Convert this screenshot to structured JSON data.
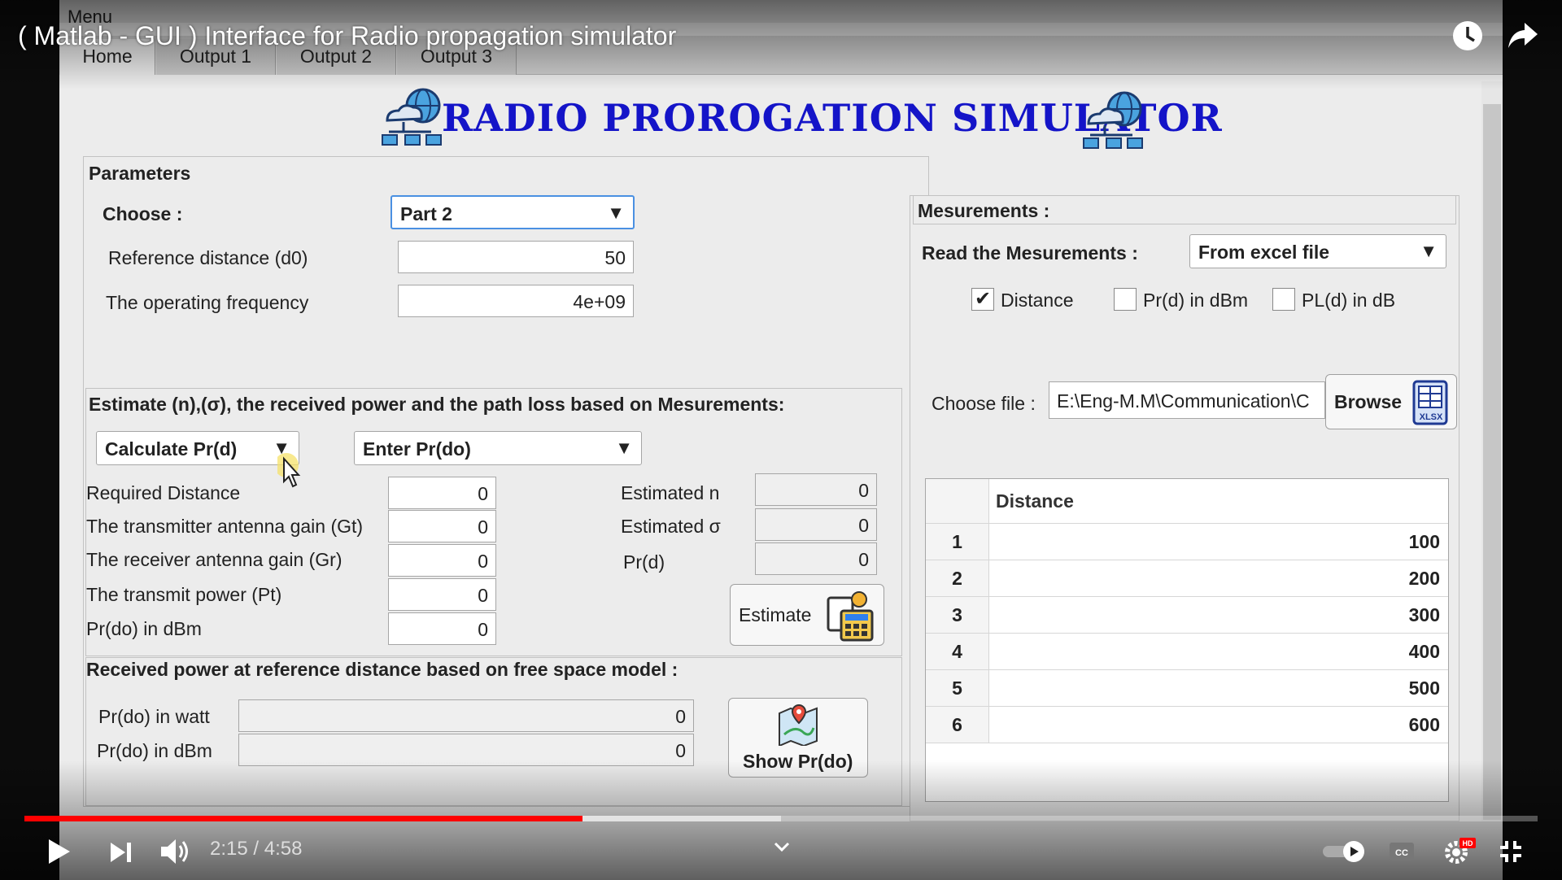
{
  "video": {
    "title": "( Matlab - GUI ) Interface for Radio propagation simulator",
    "time": "2:15 / 4:58",
    "progress_played_fraction": 0.369,
    "progress_buffered_fraction": 0.5
  },
  "app": {
    "menu": "Menu",
    "tabs": [
      {
        "label": "Home",
        "active": true
      },
      {
        "label": "Output 1",
        "active": false
      },
      {
        "label": "Output 2",
        "active": false
      },
      {
        "label": "Output 3",
        "active": false
      }
    ],
    "banner_title": "RADIO PROROGATION SIMULATOR"
  },
  "parameters": {
    "title": "Parameters",
    "choose_label": "Choose :",
    "choose_value": "Part 2",
    "ref_distance_label": "Reference distance (d0)",
    "ref_distance_value": "50",
    "frequency_label": "The operating frequency",
    "frequency_value": "4e+09"
  },
  "estimate": {
    "title": "Estimate (n),(σ), the received power and the path loss based on Mesurements:",
    "calc_dropdown": "Calculate Pr(d)",
    "enter_dropdown": "Enter Pr(do)",
    "inputs": [
      {
        "label": "Required Distance",
        "value": "0"
      },
      {
        "label": "The transmitter antenna gain (Gt)",
        "value": "0"
      },
      {
        "label": "The receiver antenna gain (Gr)",
        "value": "0"
      },
      {
        "label": "The transmit power (Pt)",
        "value": "0"
      },
      {
        "label": "Pr(do) in dBm",
        "value": "0"
      }
    ],
    "outputs": [
      {
        "label": "Estimated n",
        "value": "0"
      },
      {
        "label": "Estimated σ",
        "value": "0"
      },
      {
        "label": "Pr(d)",
        "value": "0"
      }
    ],
    "button_label": "Estimate"
  },
  "free_space": {
    "title": "Received power at reference distance based on free space model :",
    "watt_label": "Pr(do) in watt",
    "watt_value": "0",
    "dbm_label": "Pr(do) in dBm",
    "dbm_value": "0",
    "button_label": "Show Pr(do)"
  },
  "measurements": {
    "title": "Mesurements :",
    "read_label": "Read the Mesurements :",
    "read_value": "From excel file",
    "checkboxes": [
      {
        "label": "Distance",
        "checked": true
      },
      {
        "label": "Pr(d) in dBm",
        "checked": false
      },
      {
        "label": "PL(d) in dB",
        "checked": false
      }
    ],
    "choose_file_label": "Choose file :",
    "file_path": "E:\\Eng-M.M\\Communication\\C",
    "browse_label": "Browse",
    "xlsx_badge": "XLSX",
    "table": {
      "column": "Distance",
      "rows": [
        {
          "index": "1",
          "value": "100"
        },
        {
          "index": "2",
          "value": "200"
        },
        {
          "index": "3",
          "value": "300"
        },
        {
          "index": "4",
          "value": "400"
        },
        {
          "index": "5",
          "value": "500"
        },
        {
          "index": "6",
          "value": "600"
        }
      ]
    }
  }
}
